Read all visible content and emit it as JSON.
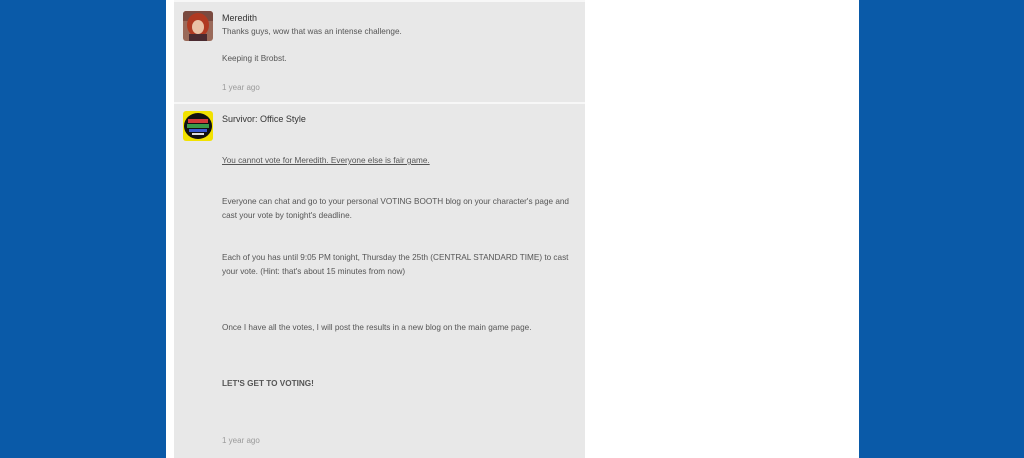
{
  "colors": {
    "background": "#0a5aa8",
    "page": "#ffffff",
    "feed": "#e8e8e8"
  },
  "comments": [
    {
      "author": "Meredith",
      "avatar": "meredith-avatar",
      "lines": [
        "Thanks guys, wow that was an intense challenge.",
        "Keeping it Brobst."
      ],
      "time": "1 year ago"
    },
    {
      "author": "Survivor: Office Style",
      "avatar": "survivor-logo",
      "lines": [
        "You cannot vote for Meredith.  Everyone else is fair game.",
        "Everyone can chat and go to your personal VOTING BOOTH blog on your character's page and cast your vote by tonight's deadline.",
        "Each of you has until 9:05 PM tonight, Thursday the 25th (CENTRAL STANDARD TIME) to cast your vote.   (Hint:  that's about 15 minutes from now)",
        "Once I have all the votes, I will post the results in a new blog on the main game page.",
        "LET'S GET TO VOTING!"
      ],
      "time": "1 year ago"
    }
  ]
}
